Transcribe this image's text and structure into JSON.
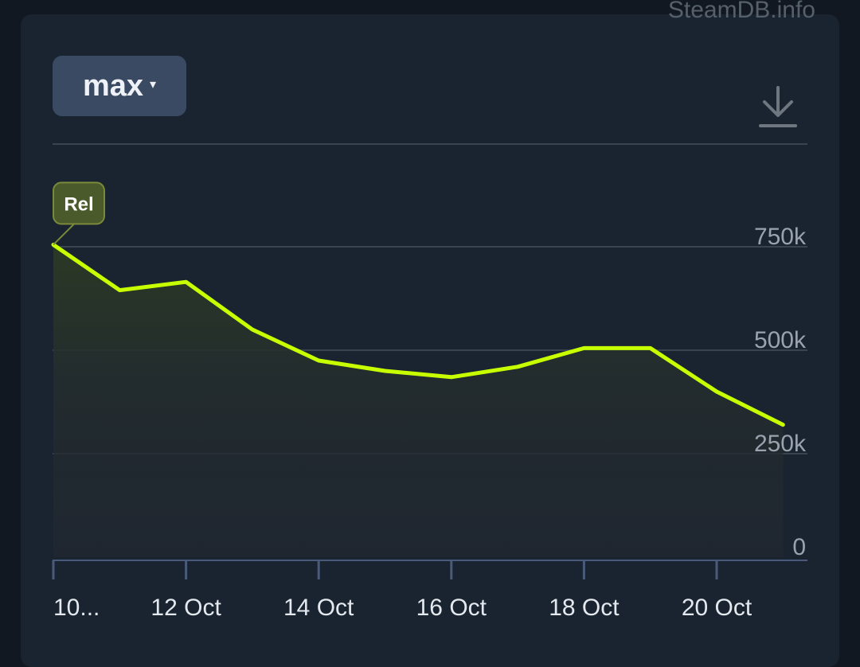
{
  "watermark": "SteamDB.info",
  "toolbar": {
    "range_label": "max",
    "range_caret": "▾",
    "download_icon": "download-icon"
  },
  "colors": {
    "line": "#c8ff00",
    "grid": "#3a4450",
    "flag_bg": "#4a5a2a",
    "flag_border": "#7a8a3a"
  },
  "chart_data": {
    "type": "area",
    "x": [
      "2024-10-10",
      "2024-10-11",
      "2024-10-12",
      "2024-10-13",
      "2024-10-14",
      "2024-10-15",
      "2024-10-16",
      "2024-10-17",
      "2024-10-18",
      "2024-10-19",
      "2024-10-20",
      "2024-10-21"
    ],
    "series": [
      {
        "values": [
          755000,
          645000,
          665000,
          550000,
          475000,
          450000,
          435000,
          460000,
          505000,
          505000,
          400000,
          320000
        ]
      }
    ],
    "xticks": [
      "10...",
      "12 Oct",
      "14 Oct",
      "16 Oct",
      "18 Oct",
      "20 Oct"
    ],
    "yticks": [
      "0",
      "250k",
      "500k",
      "750k"
    ],
    "ylim": [
      0,
      1000000
    ],
    "grid": true,
    "annotations": [
      {
        "label": "Rel",
        "x": "2024-10-10"
      }
    ]
  }
}
